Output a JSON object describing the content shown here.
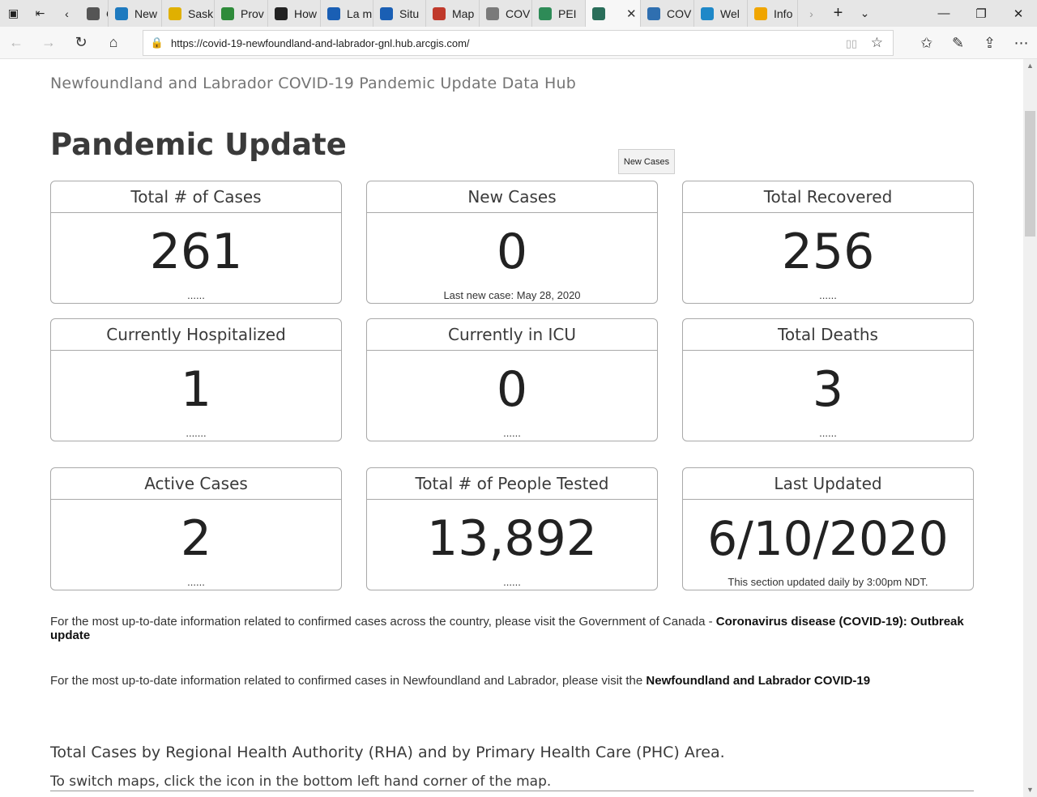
{
  "browser": {
    "tabs": [
      {
        "label": "Case",
        "icon": "document-icon",
        "color": "#555555"
      },
      {
        "label": "New",
        "icon": "chart-icon",
        "color": "#1e7abf"
      },
      {
        "label": "Sask",
        "icon": "wheat-icon",
        "color": "#e0b000"
      },
      {
        "label": "Prov",
        "icon": "province-flag-icon",
        "color": "#2e8b3a"
      },
      {
        "label": "How",
        "icon": "shield-icon",
        "color": "#222222"
      },
      {
        "label": "La m",
        "icon": "fleur-de-lis-icon",
        "color": "#1a5fb4"
      },
      {
        "label": "Situ",
        "icon": "fleur-de-lis-icon",
        "color": "#1a5fb4"
      },
      {
        "label": "Map",
        "icon": "map-pin-icon",
        "color": "#c0392b"
      },
      {
        "label": "COV",
        "icon": "document-icon",
        "color": "#7a7a7a"
      },
      {
        "label": "PEI",
        "icon": "tree-icon",
        "color": "#2e8b57"
      },
      {
        "label": "",
        "icon": "globe-icon",
        "color": "#2a6e5a"
      },
      {
        "label": "COV",
        "icon": "map-icon",
        "color": "#2f6fb0"
      },
      {
        "label": "Wel",
        "icon": "wave-icon",
        "color": "#1e88c8"
      },
      {
        "label": "Info",
        "icon": "sun-icon",
        "color": "#f0a500"
      }
    ],
    "url": "https://covid-19-newfoundland-and-labrador-gnl.hub.arcgis.com/"
  },
  "page": {
    "site_title": "Newfoundland and Labrador COVID-19 Pandemic Update Data Hub",
    "title": "Pandemic Update",
    "tooltip": "New Cases"
  },
  "cards": [
    {
      "title": "Total # of Cases",
      "value": "261",
      "footer": "......"
    },
    {
      "title": "New Cases",
      "value": "0",
      "footer": "Last new case: May 28, 2020"
    },
    {
      "title": "Total Recovered",
      "value": "256",
      "footer": "......"
    },
    {
      "title": "Currently Hospitalized",
      "value": "1",
      "footer": "......."
    },
    {
      "title": "Currently in ICU",
      "value": "0",
      "footer": "......"
    },
    {
      "title": "Total Deaths",
      "value": "3",
      "footer": "......"
    },
    {
      "title": "Active Cases",
      "value": "2",
      "footer": "......"
    },
    {
      "title": "Total # of People Tested",
      "value": "13,892",
      "footer": "......"
    },
    {
      "title": "Last Updated",
      "value": "6/10/2020",
      "footer": "This section updated daily by 3:00pm NDT."
    }
  ],
  "info": {
    "p1_text": "For the most up-to-date information related to confirmed cases across the country, please visit the Government of Canada - ",
    "p1_link": "Coronavirus disease (COVID-19): Outbreak update",
    "p2_text": "For the most up-to-date information related to confirmed cases in Newfoundland and Labrador, please visit the ",
    "p2_link": "Newfoundland and Labrador COVID-19"
  },
  "rha": {
    "title": "Total Cases by Regional Health Authority (RHA) and by Primary Health Care (PHC) Area.",
    "subtitle": "To switch maps, click the icon in the bottom left hand corner of the map."
  }
}
